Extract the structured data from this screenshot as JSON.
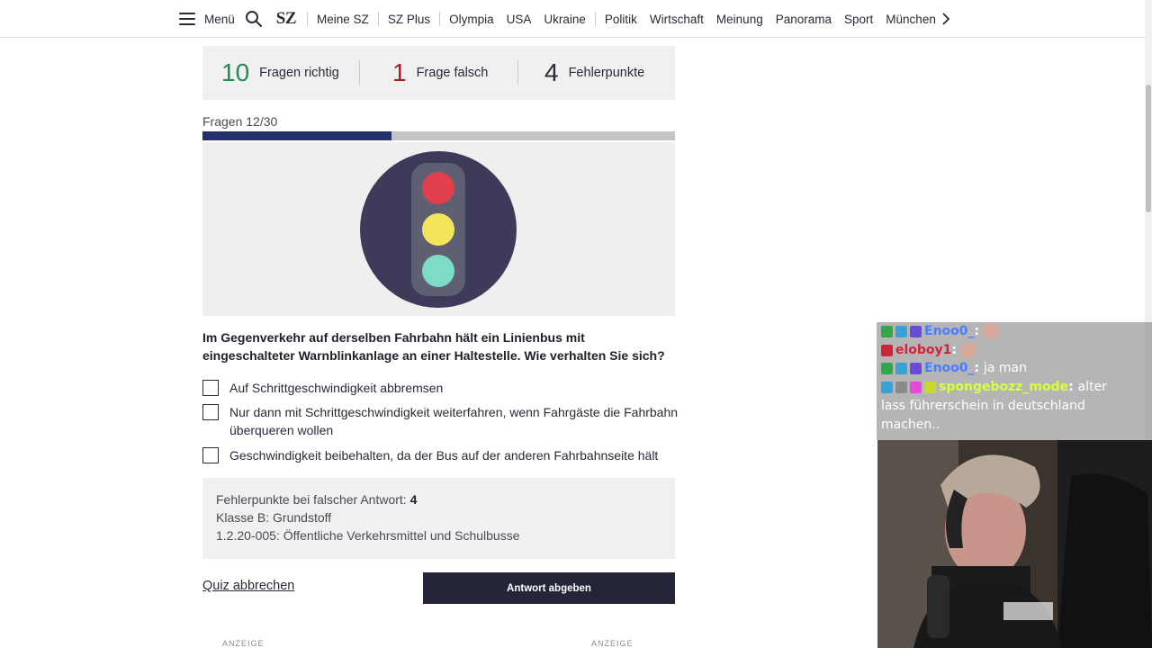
{
  "nav": {
    "menu_label": "Menü",
    "logo": "SZ",
    "links": [
      "Meine SZ",
      "SZ Plus",
      "Olympia",
      "USA",
      "Ukraine",
      "Politik",
      "Wirtschaft",
      "Meinung",
      "Panorama",
      "Sport"
    ],
    "clipped_link": "München"
  },
  "score": {
    "correct_count": "10",
    "correct_label": "Fragen richtig",
    "wrong_count": "1",
    "wrong_label": "Frage falsch",
    "points_count": "4",
    "points_label": "Fehlerpunkte",
    "colors": {
      "correct": "#1a8f55",
      "wrong": "#b1161c",
      "points": "#29293a"
    }
  },
  "progress": {
    "label": "Fragen 12/30",
    "fill_fraction": 0.4
  },
  "illustration": {
    "icon": "traffic-light-icon",
    "colors": {
      "red": "#e0404b",
      "yellow": "#f2e55c",
      "green": "#7ddcc5",
      "disc": "#3e3a59",
      "housing": "#5f5f73"
    }
  },
  "question": {
    "text": "Im Gegenverkehr auf derselben Fahrbahn hält ein Linienbus mit eingeschalteter Warnblinkanlage an einer Haltestelle. Wie verhalten Sie sich?",
    "answers": [
      "Auf Schrittgeschwindigkeit abbremsen",
      "Nur dann mit Schrittgeschwindigkeit weiterfahren, wenn Fahrgäste die Fahrbahn überqueren wollen",
      "Geschwindigkeit beibehalten, da der Bus auf der anderen Fahrbahnseite hält"
    ]
  },
  "info": {
    "points_label": "Fehlerpunkte bei falscher Antwort: ",
    "points_value": "4",
    "class_line": "Klasse B: Grundstoff",
    "topic_line": "1.2.20-005: Öffentliche Verkehrsmittel und Schulbusse"
  },
  "actions": {
    "abort_label": "Quiz abbrechen",
    "submit_label": "Antwort abgeben"
  },
  "ads": [
    "ANZEIGE",
    "ANZEIGE"
  ],
  "chat": {
    "lines": [
      {
        "user": "Enoo0_",
        "color": "#4a7dff",
        "message": ""
      },
      {
        "user": "eloboy1",
        "color": "#d0243c",
        "message": ""
      },
      {
        "user": "Enoo0_",
        "color": "#4a7dff",
        "message": "ja man"
      },
      {
        "user": "spongebozz_mode",
        "color": "#d8ff3c",
        "message": "alter"
      }
    ],
    "continuation_1": "lass führerschein in deutschland",
    "continuation_2": "machen.."
  }
}
